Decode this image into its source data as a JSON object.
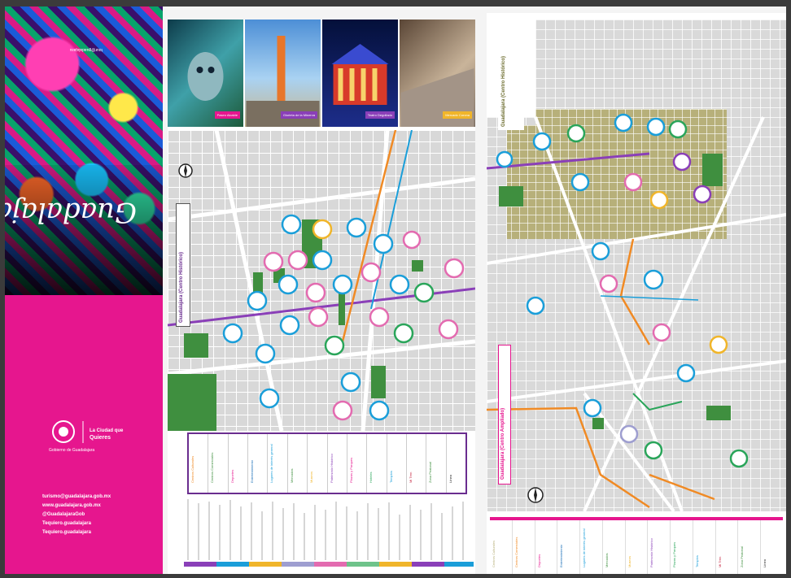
{
  "brand": {
    "header_text": "tour@guadalajara",
    "logo_text": "Guadalajara",
    "seal_label": "Gobierno de Guadalajara",
    "slogan": "La Ciudad que Quieres",
    "contact": [
      "turismo@guadalajara.gob.mx",
      "www.guadalajara.gob.mx",
      "@GuadalajaraGob",
      "Tequiero.guadalajara",
      "Tequiero.guadalajara"
    ]
  },
  "mid": {
    "photo_captions": [
      "Paseo Alcalde",
      "Glorieta de la Minerva",
      "Teatro Degollado",
      "Mercado Corona"
    ],
    "map_title": "Guadalajara (Centro Histórico)",
    "legend_items": [
      "Centros Culturales",
      "Centros Comerciales",
      "Deportes",
      "Entretenimiento",
      "Lugares de interés general",
      "Mercados",
      "Museos",
      "Patrimonio Histórico",
      "Plazas y Parques",
      "Hoteles",
      "Templos",
      "Mi Tren",
      "Zona Peatonal",
      "Línea"
    ]
  },
  "right": {
    "map_title": "Guadalajara (Centro Ampliado)",
    "side_title": "Guadalajara (Centro Histórico)",
    "legend_items": [
      "Centros Culturales",
      "Centros Comerciales",
      "Deportes",
      "Entretenimiento",
      "Lugares de interés general",
      "Mercados",
      "Museos",
      "Patrimonio Histórico",
      "Plazas y Parques",
      "Templos",
      "Mi Tren",
      "Zona Peatonal",
      "Línea"
    ]
  },
  "colors": {
    "brand_pink": "#e6168e",
    "park_green": "#3f8f3f",
    "historic_olive": "#b7b07a",
    "metro_blue": "#1a9ed9",
    "line_orange": "#f08a24",
    "line_purple": "#8a3fb8"
  }
}
